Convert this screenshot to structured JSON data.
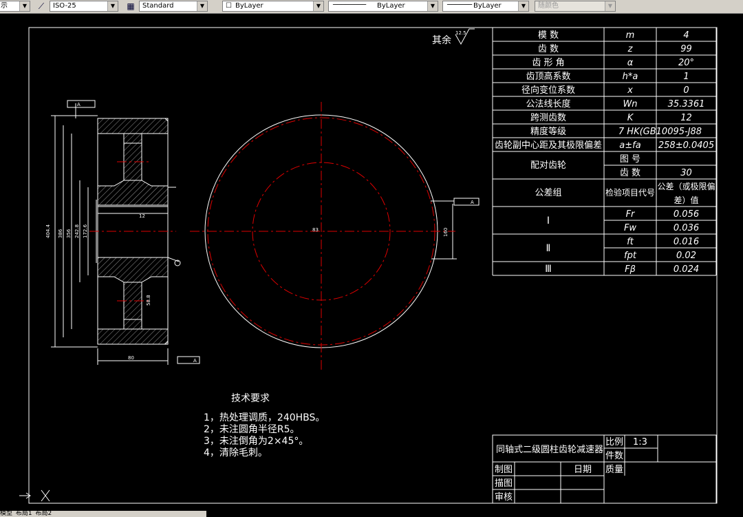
{
  "toolbar": {
    "left_fragment": "示",
    "dimstyle": "ISO-25",
    "textstyle": "Standard",
    "layer_label": "ByLayer",
    "linetype_label": "ByLayer",
    "lineweight_label": "ByLayer",
    "color_label": "随颜色"
  },
  "roughness": {
    "label": "其余",
    "value": "12.5"
  },
  "param_table": {
    "rows": [
      {
        "name": "模    数",
        "symbol": "m",
        "value": "4"
      },
      {
        "name": "齿    数",
        "symbol": "z",
        "value": "99"
      },
      {
        "name": "齿 形 角",
        "symbol": "α",
        "value": "20°"
      },
      {
        "name": "齿顶高系数",
        "symbol": "h*a",
        "value": "1"
      },
      {
        "name": "径向变位系数",
        "symbol": "x",
        "value": "0"
      },
      {
        "name": "公法线长度",
        "symbol": "Wn",
        "value": "35.3361"
      },
      {
        "name": "跨测齿数",
        "symbol": "K",
        "value": "12"
      },
      {
        "name": "精度等级",
        "symbol": "7 HK(GB10095-J88",
        "value": ""
      },
      {
        "name": "齿轮副中心距及其极限偏差",
        "symbol": "a±fa",
        "value": "258±0.0405"
      }
    ],
    "pair_label": "配对齿轮",
    "pair_rows": [
      {
        "name": "图  号",
        "value": ""
      },
      {
        "name": "齿  数",
        "value": "30"
      }
    ],
    "tol_header": {
      "group": "公差组",
      "code": "检验项目代号",
      "value_line1": "公差（或极限偏",
      "value_line2": "差）值"
    },
    "tol_rows": [
      {
        "group": "Ⅰ",
        "code": "Fr",
        "value": "0.056"
      },
      {
        "group": "",
        "code": "Fw",
        "value": "0.036"
      },
      {
        "group": "Ⅱ",
        "code": "ft",
        "value": "0.016"
      },
      {
        "group": "",
        "code": "fpt",
        "value": "0.02"
      },
      {
        "group": "Ⅲ",
        "code": "Fβ",
        "value": "0.024"
      }
    ]
  },
  "tech_requirements": {
    "title": "技术要求",
    "items": [
      "1，热处理调质，240HBS。",
      "2，未注圆角半径R5。",
      "3，未注倒角为2×45°。",
      "4，清除毛刺。"
    ]
  },
  "title_block": {
    "title": "同轴式二级圆柱齿轮减速器",
    "scale_label": "比例",
    "scale_value": "1:3",
    "count_label": "件数",
    "mass_label": "质量",
    "drawn_label": "制图",
    "date_label": "日期",
    "traced_label": "描图",
    "checked_label": "审核"
  },
  "dimensions": {
    "d_tip": "404.4",
    "d_root": "386",
    "d_body": "356",
    "d_web": "242.8",
    "d_hub": "172.6",
    "d_bore": "83",
    "hub_len": "80",
    "key_depth": "58.8",
    "width": "80",
    "slot": "12",
    "center_small": "160",
    "datum": "A"
  },
  "tabs": [
    "模型",
    "布局1",
    "布局2"
  ]
}
